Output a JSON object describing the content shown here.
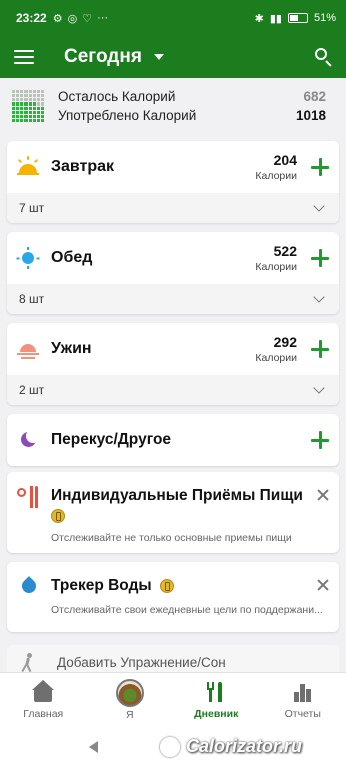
{
  "status_bar": {
    "time": "23:22",
    "battery": "51%",
    "battery_level": 0.51
  },
  "app_bar": {
    "title": "Сегодня"
  },
  "summary": {
    "remaining_label": "Осталось Калорий",
    "remaining_value": "682",
    "consumed_label": "Употреблено Калорий",
    "consumed_value": "1018",
    "progress_fraction": 0.6
  },
  "meals": [
    {
      "name": "Завтрак",
      "calories": "204",
      "calories_label": "Калории",
      "count": "7 шт"
    },
    {
      "name": "Обед",
      "calories": "522",
      "calories_label": "Калории",
      "count": "8 шт"
    },
    {
      "name": "Ужин",
      "calories": "292",
      "calories_label": "Калории",
      "count": "2 шт"
    },
    {
      "name": "Перекус/Другое"
    }
  ],
  "info_cards": [
    {
      "title": "Индивидуальные Приёмы Пищи",
      "subtitle": "Отслеживайте не только основные приемы пищи"
    },
    {
      "title": "Трекер Воды",
      "subtitle": "Отслеживайте свои ежедневные цели по поддержани..."
    }
  ],
  "exercise": {
    "label": "Добавить Упражнение/Сон"
  },
  "bottom_nav": [
    {
      "label": "Главная"
    },
    {
      "label": "Я"
    },
    {
      "label": "Дневник"
    },
    {
      "label": "Отчеты"
    }
  ],
  "watermark": {
    "text": "Calorizator.ru"
  },
  "colors": {
    "primary": "#1b7d1d",
    "accent_plus": "#1f9a2c",
    "background": "#f1f1f3"
  }
}
